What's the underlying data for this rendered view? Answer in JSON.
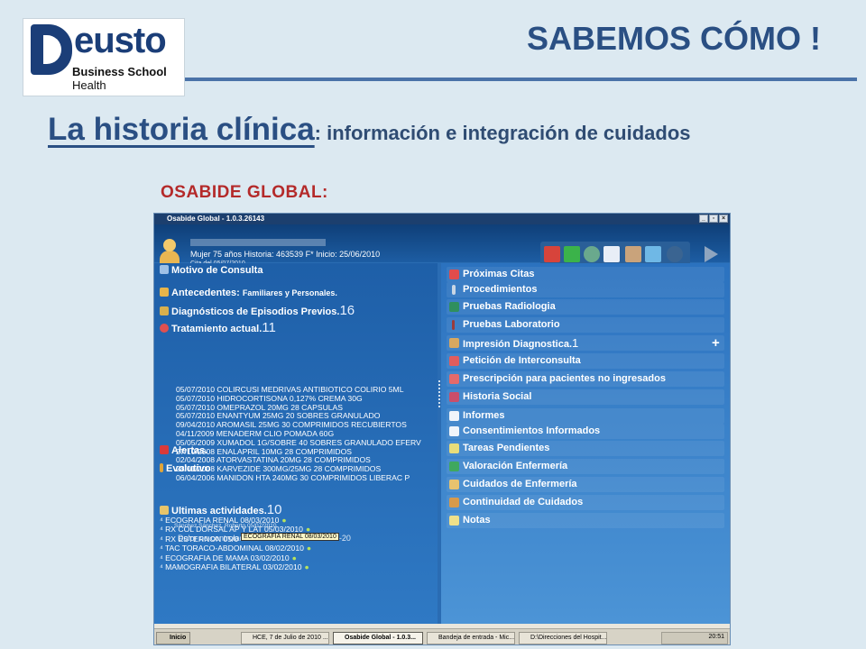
{
  "logo": {
    "word": "eusto",
    "sub1": "Business School",
    "sub2": "Health"
  },
  "slogan": "SABEMOS CÓMO !",
  "title": {
    "main": "La historia clínica",
    "sub": ": información e integración de cuidados"
  },
  "section_label": "OSABIDE GLOBAL:",
  "app": {
    "window_title": "Osabide Global - 1.0.3.26143",
    "patient_info": "Mujer  75 años  Historia: 463539  F* Inicio: 25/06/2010",
    "patient_info2": "Cita del 05/07/2010",
    "left": {
      "motivo": "Motivo de Consulta",
      "antecedentes": "Antecedentes:",
      "antecedentes_sub": "Familiares y Personales.",
      "diagnosticos": "Diagnósticos de Episodios Previos.",
      "diagnosticos_count": "16",
      "tratamiento": "Tratamiento actual.",
      "tratamiento_count": "11",
      "treatments": [
        "05/07/2010  COLIRCUSI MEDRIVAS ANTIBIOTICO COLIRIO 5ML",
        "05/07/2010  HIDROCORTISONA 0,127% CREMA 30G",
        "05/07/2010  OMEPRAZOL 20MG 28 CAPSULAS",
        "05/07/2010  ENANTYUM 25MG 20 SOBRES GRANULADO",
        "09/04/2010  AROMASIL 25MG 30 COMPRIMIDOS RECUBIERTOS",
        "04/11/2009  MENADERM CLIO POMADA 60G",
        "05/05/2009  XUMADOL 1G/SOBRE 40 SOBRES GRANULADO EFERV",
        "27/10/2008  ENALAPRIL 10MG 28 COMPRIMIDOS",
        "02/04/2008  ATORVASTATINA 20MG 28 COMPRIMIDOS",
        "28/01/2008  KARVEZIDE 300MG/25MG 28 COMPRIMIDOS",
        "06/04/2006  MANIDON HTA 240MG 30 COMPRIMIDOS LIBERAC P"
      ],
      "alertas": "Alertas.",
      "evolutivo": "Evolutivo",
      "evolutivo_author": "Sánchez Sánchez, Roberto    05/07/2010",
      "evolutivo_text": "Dolor no controlado. Indico subir a MST 20-0-20",
      "ultimas": "Ultimas actividades.",
      "ultimas_count": "10",
      "activities": [
        "ECOGRAFIA RENAL 08/03/2010",
        "RX COL DORSAL AP Y LAT 05/03/2010",
        "RX ESTERNON 05/0",
        "TAC TORACO-ABDOMINAL 08/02/2010",
        "ECOGRAFIA DE MAMA 03/02/2010",
        "MAMOGRAFIA BILATERAL 03/02/2010"
      ],
      "tooltip": "ECOGRAFIA RENAL 08/03/2010"
    },
    "right": [
      "Próximas Citas",
      "Procedimientos",
      "Pruebas Radiologia",
      "Pruebas Laboratorio",
      "Impresión Diagnostica.",
      "Petición de Interconsulta",
      "Prescripción para pacientes no ingresados",
      "Historia Social",
      "Informes",
      "Consentimientos Informados",
      "Tareas Pendientes",
      "Valoración Enfermería",
      "Cuidados de Enfermería",
      "Continuidad de Cuidados",
      "Notas"
    ],
    "impresion_count": "1",
    "plus": "+",
    "taskbar": {
      "start": "Inicio",
      "tasks": [
        "HCE, 7 de Julio de 2010 ...",
        "Osabide Global - 1.0.3...",
        "Bandeja de entrada - Mic...",
        "D:\\Direcciones del Hospit..."
      ],
      "clock": "20:51"
    }
  },
  "colors": {
    "brand": "#1b3e78",
    "accent": "#2a4f83",
    "label_red": "#b42a2a"
  }
}
